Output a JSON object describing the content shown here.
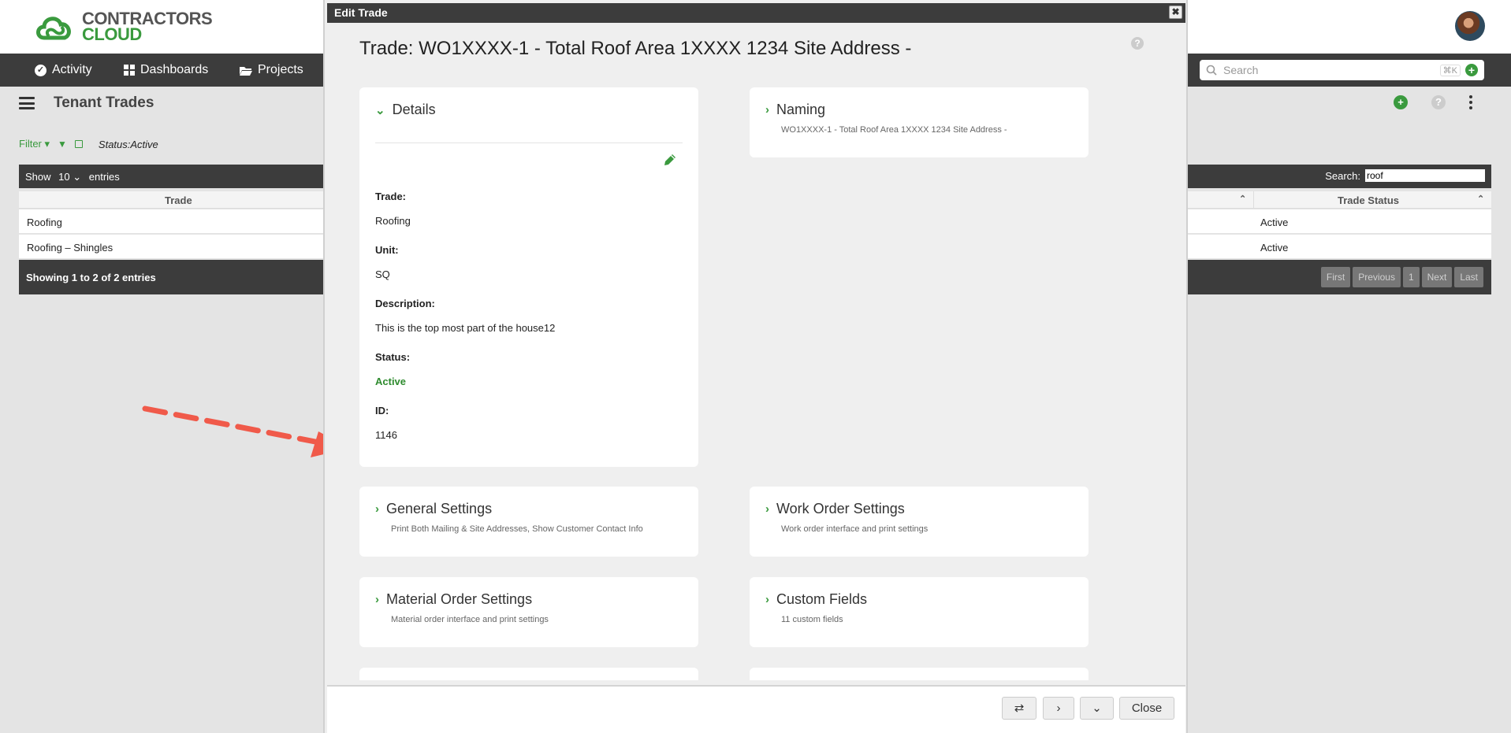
{
  "app": {
    "logo_line1": "CONTRACTORS",
    "logo_line2": "CLOUD",
    "brand_color": "#3a9a3e"
  },
  "nav": {
    "items": [
      {
        "label": "Activity",
        "icon": "check-circle-icon"
      },
      {
        "label": "Dashboards",
        "icon": "grid-icon"
      },
      {
        "label": "Projects",
        "icon": "folder-open-icon"
      }
    ],
    "search_placeholder": "Search",
    "search_shortcut": "⌘K"
  },
  "page": {
    "title": "Tenant Trades",
    "filter_label": "Filter",
    "filter_status": "Status:Active"
  },
  "table": {
    "show_label": "Show",
    "show_value": "10",
    "entries_label": "entries",
    "search_label": "Search:",
    "search_value": "roof",
    "columns": [
      "Trade",
      "Trade Status"
    ],
    "rows": [
      {
        "trade": "Roofing",
        "status": "Active"
      },
      {
        "trade": "Roofing – Shingles",
        "status": "Active"
      }
    ],
    "footer_info": "Showing 1 to 2 of 2 entries",
    "pager": [
      "First",
      "Previous",
      "1",
      "Next",
      "Last"
    ]
  },
  "modal": {
    "header": "Edit Trade",
    "title": "Trade: WO1XXXX-1 - Total Roof Area 1XXXX 1234 Site Address -",
    "details": {
      "heading": "Details",
      "fields": [
        {
          "label": "Trade:",
          "value": "Roofing"
        },
        {
          "label": "Unit:",
          "value": "SQ"
        },
        {
          "label": "Description:",
          "value": "This is the top most part of the house12"
        },
        {
          "label": "Status:",
          "value": "Active"
        },
        {
          "label": "ID:",
          "value": "1146"
        }
      ]
    },
    "naming": {
      "heading": "Naming",
      "sub": "WO1XXXX-1 - Total Roof Area 1XXXX 1234 Site Address -"
    },
    "sections": [
      {
        "heading": "General Settings",
        "sub": "Print Both Mailing & Site Addresses, Show Customer Contact Info"
      },
      {
        "heading": "Work Order Settings",
        "sub": "Work order interface and print settings"
      },
      {
        "heading": "Material Order Settings",
        "sub": "Material order interface and print settings"
      },
      {
        "heading": "Custom Fields",
        "sub": "11 custom fields"
      }
    ],
    "close_label": "Close"
  }
}
